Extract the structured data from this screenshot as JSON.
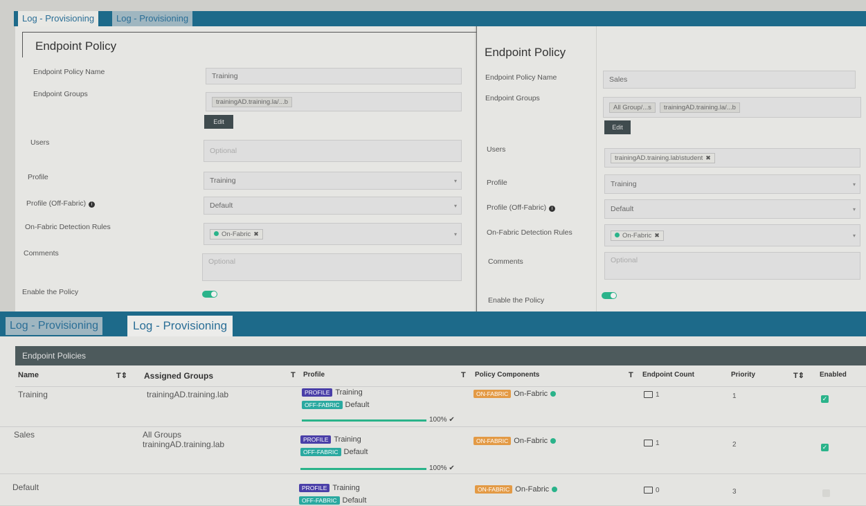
{
  "top_tabs": [
    "Log - Provisioning",
    "Log - Provisioning"
  ],
  "left_form": {
    "title": "Endpoint Policy",
    "name_label": "Endpoint Policy Name",
    "name_value": "Training",
    "groups_label": "Endpoint Groups",
    "groups": [
      "trainingAD.training.la/...b"
    ],
    "edit_label": "Edit",
    "users_label": "Users",
    "users_placeholder": "Optional",
    "profile_label": "Profile",
    "profile_value": "Training",
    "offfabric_label": "Profile (Off-Fabric)",
    "offfabric_value": "Default",
    "rules_label": "On-Fabric Detection Rules",
    "rule_chip": "On-Fabric",
    "comments_label": "Comments",
    "comments_placeholder": "Optional",
    "enable_label": "Enable the Policy"
  },
  "right_form": {
    "title": "Endpoint Policy",
    "name_label": "Endpoint Policy Name",
    "name_value": "Sales",
    "groups_label": "Endpoint Groups",
    "groups": [
      "All Group/...s",
      "trainingAD.training.la/...b"
    ],
    "edit_label": "Edit",
    "users_label": "Users",
    "user_chip": "trainingAD.training.lab\\student",
    "profile_label": "Profile",
    "profile_value": "Training",
    "offfabric_label": "Profile (Off-Fabric)",
    "offfabric_value": "Default",
    "rules_label": "On-Fabric Detection Rules",
    "rule_chip": "On-Fabric",
    "comments_label": "Comments",
    "comments_placeholder": "Optional",
    "enable_label": "Enable the Policy"
  },
  "bottom_tabs": [
    "Log - Provisioning",
    "Log - Provisioning"
  ],
  "table": {
    "panel_title": "Endpoint Policies",
    "headers": {
      "name": "Name",
      "groups": "Assigned Groups",
      "profile": "Profile",
      "components": "Policy Components",
      "count": "Endpoint Count",
      "priority": "Priority",
      "enabled": "Enabled"
    },
    "filter_icons": [
      "T",
      "T",
      "T",
      "T",
      "T"
    ],
    "sort_icon": "⇕",
    "rows": [
      {
        "name": "Training",
        "groups": [
          "trainingAD.training.lab"
        ],
        "profile_badge": "PROFILE",
        "profile": "Training",
        "off_badge": "OFF-FABRIC",
        "off": "Default",
        "progress": "100%",
        "on_badge": "ON-FABRIC",
        "component": "On-Fabric",
        "count": "1",
        "priority": "1",
        "enabled": true
      },
      {
        "name": "Sales",
        "groups": [
          "All Groups",
          "trainingAD.training.lab"
        ],
        "profile_badge": "PROFILE",
        "profile": "Training",
        "off_badge": "OFF-FABRIC",
        "off": "Default",
        "progress": "100%",
        "on_badge": "ON-FABRIC",
        "component": "On-Fabric",
        "count": "1",
        "priority": "2",
        "enabled": true
      },
      {
        "name": "Default",
        "groups": [],
        "profile_badge": "PROFILE",
        "profile": "Training",
        "off_badge": "OFF-FABRIC",
        "off": "Default",
        "progress": "",
        "on_badge": "ON-FABRIC",
        "component": "On-Fabric",
        "count": "0",
        "priority": "3",
        "enabled": false
      }
    ]
  },
  "colors": {
    "accent": "#2ab38a",
    "tabbar": "#1d6a8a",
    "profile_badge": "#4a3fa8",
    "offfabric_badge": "#2aa9a0",
    "onfabric_badge": "#e39a45"
  }
}
